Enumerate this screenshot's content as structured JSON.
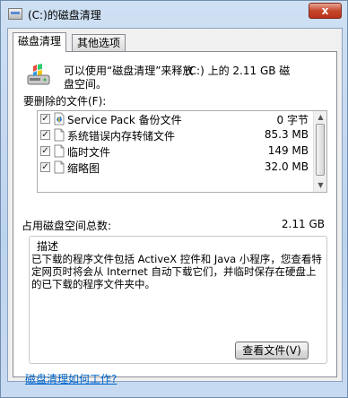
{
  "window": {
    "title": "(C:)的磁盘清理",
    "close_glyph": "x"
  },
  "tabs": [
    {
      "label": "磁盘清理",
      "active": true
    },
    {
      "label": "其他选项",
      "active": false
    }
  ],
  "summary": {
    "line1_prefix": "可以使用“磁盘清理”来释放",
    "line1_amount": "(C:) 上的 2.11 GB 磁",
    "line2": "盘空间。"
  },
  "files_label": "要删除的文件(F):",
  "files": [
    {
      "checked": true,
      "icon": "shield-file-icon",
      "name": "Service Pack 备份文件",
      "size": "0 字节"
    },
    {
      "checked": true,
      "icon": "file-icon",
      "name": "系统错误内存转储文件",
      "size": "85.3 MB"
    },
    {
      "checked": true,
      "icon": "file-icon",
      "name": "临时文件",
      "size": "149 MB"
    },
    {
      "checked": true,
      "icon": "file-icon",
      "name": "缩略图",
      "size": "32.0 MB"
    }
  ],
  "total": {
    "label": "占用磁盘空间总数:",
    "value": "2.11 GB"
  },
  "description": {
    "title": "描述",
    "text": "已下载的程序文件包括 ActiveX 控件和 Java 小程序，您查看特定网页时将会从 Internet 自动下载它们，并临时保存在硬盘上的已下载的程序文件夹中。",
    "view_button": "查看文件(V)"
  },
  "help_link": "磁盘清理如何工作?",
  "colors": {
    "link": "#0066cc",
    "close_button": "#c7472b"
  }
}
